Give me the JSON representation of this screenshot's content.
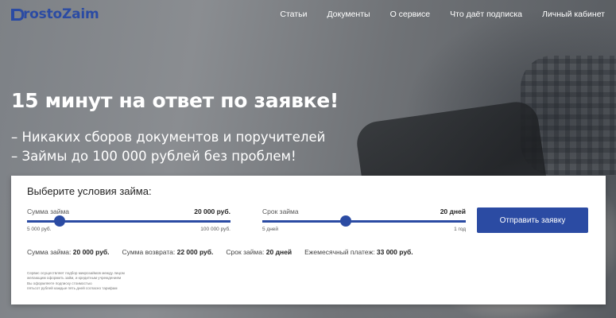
{
  "header": {
    "logo_text": "ProstoZaim",
    "nav": [
      "Статьи",
      "Документы",
      "О сервисе",
      "Что даёт подписка",
      "Личный кабинет"
    ]
  },
  "hero": {
    "title": "15 минут на ответ по заявке!",
    "lines": [
      "– Никаких сборов документов и поручителей",
      "– Займы до 100 000 рублей без проблем!"
    ]
  },
  "form": {
    "title": "Выберите условия займа:",
    "amount": {
      "label": "Сумма займа",
      "value": "20 000 руб.",
      "min_label": "5 000 руб.",
      "max_label": "100 000 руб.",
      "fraction": 0.16
    },
    "term": {
      "label": "Срок займа",
      "value": "20 дней",
      "min_label": "5 дней",
      "max_label": "1 год",
      "fraction": 0.41
    },
    "submit_label": "Отправить заявку",
    "summary": [
      {
        "label": "Сумма займа:",
        "value": "20 000 руб."
      },
      {
        "label": "Сумма возврата:",
        "value": "22 000 руб."
      },
      {
        "label": "Срок займа:",
        "value": "20 дней"
      },
      {
        "label": "Ежемесячный платеж:",
        "value": "33 000 руб."
      }
    ],
    "disclaimer": [
      "Сервис осуществляет подбор микрозаймов между лицом",
      "желающим оформить займ, и кредитным учреждением",
      "Вы оформляете подписку стоимостью",
      "пятьсот рублей каждые пять дней согласно тарифам"
    ]
  },
  "colors": {
    "accent": "#2b4ba3",
    "panel_bg": "#ffffff",
    "hero_text": "#ffffff"
  }
}
